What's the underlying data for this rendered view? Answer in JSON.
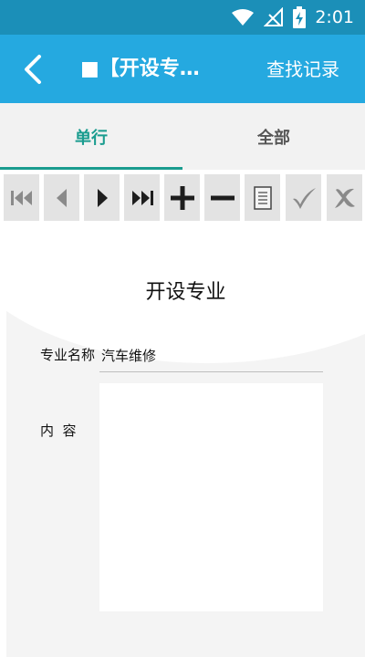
{
  "status_bar": {
    "time": "2:01",
    "icons": [
      "wifi-icon",
      "no-signal-icon",
      "battery-charging-icon"
    ]
  },
  "app_bar": {
    "back_icon": "chevron-left-icon",
    "title": "■【开设专业】",
    "action_label": "查找记录"
  },
  "tabs": [
    {
      "label": "单行",
      "selected": true
    },
    {
      "label": "全部",
      "selected": false
    }
  ],
  "nav_buttons": [
    "first-record-icon",
    "previous-record-icon",
    "next-record-icon",
    "last-record-icon",
    "add-icon",
    "delete-icon",
    "edit-icon",
    "confirm-icon",
    "cancel-icon"
  ],
  "form": {
    "title": "开设专业",
    "fields": [
      {
        "label": "专业名称",
        "value": "汽车维修"
      },
      {
        "label": "内  容",
        "value": ""
      }
    ]
  },
  "colors": {
    "status_bar": "#1b8fb8",
    "app_bar": "#25a9e0",
    "tab_active": "#1a9c8f",
    "button_bg": "#e3e3e3"
  }
}
